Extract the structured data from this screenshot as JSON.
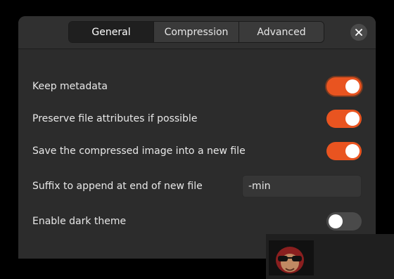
{
  "tabs": [
    {
      "label": "General",
      "active": true
    },
    {
      "label": "Compression",
      "active": false
    },
    {
      "label": "Advanced",
      "active": false
    }
  ],
  "close_icon": "close-icon",
  "settings": {
    "keep_metadata": {
      "label": "Keep metadata",
      "enabled": true
    },
    "preserve_attributes": {
      "label": "Preserve file attributes if possible",
      "enabled": true
    },
    "save_new_file": {
      "label": "Save the compressed image into a new file",
      "enabled": true
    },
    "suffix": {
      "label": "Suffix to append at end of new file",
      "value": "-min"
    },
    "dark_theme": {
      "label": "Enable dark theme",
      "enabled": false
    }
  },
  "colors": {
    "accent": "#e95420",
    "window_bg": "#2c2c2c",
    "switch_off": "#4a4a4a"
  },
  "overlay_icon": "sunglasses-face-icon"
}
